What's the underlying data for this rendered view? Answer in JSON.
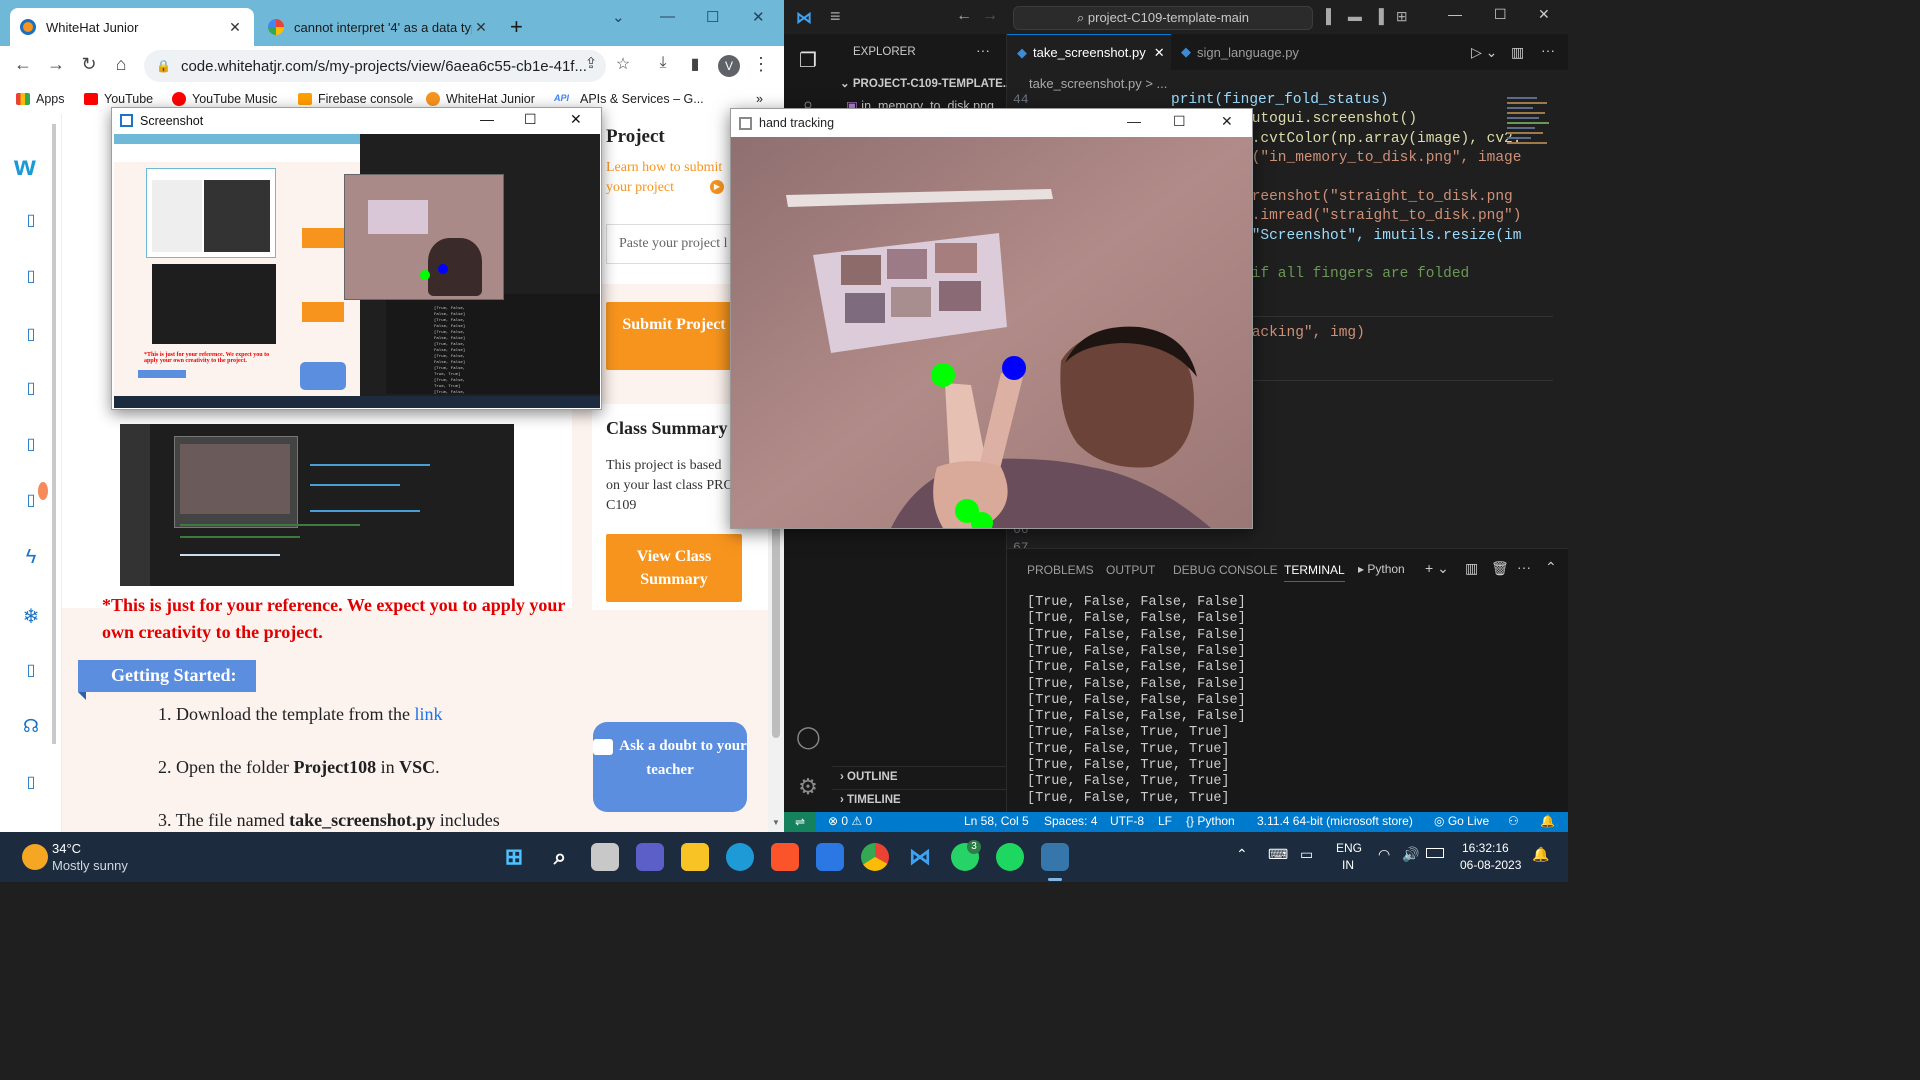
{
  "chrome": {
    "tabs": [
      {
        "title": "WhiteHat Junior",
        "close": "✕"
      },
      {
        "title": "cannot interpret '4' as a data type",
        "close": "✕"
      }
    ],
    "new_tab": "+",
    "url": "code.whitehatjr.com/s/my-projects/view/6aea6c55-cb1e-41f...",
    "profile": "V",
    "bookmarks": [
      "Apps",
      "YouTube",
      "YouTube Music",
      "Firebase console",
      "WhiteHat Junior",
      "APIs & Services – G..."
    ],
    "bookmarks_more": "»"
  },
  "page": {
    "project_heading": "Project",
    "learn_link": "Learn how to submit your project",
    "paste_placeholder": "Paste your project l",
    "submit_label": "Submit Project",
    "class_summary_title": "Class Summary",
    "class_summary_text": "This project is based on your last class PRO C109",
    "view_summary_label": "View Class Summary",
    "reference_note": "*This is just for your reference. We expect you to apply your own creativity to the project.",
    "getting_started": "Getting Started:",
    "steps": [
      {
        "prefix": "1. Download the template from the ",
        "link": "link"
      },
      {
        "prefix": "2. Open the folder ",
        "bold": "Project108",
        "suffix_pre": " in ",
        "bold2": "VSC",
        "suffix": "."
      },
      {
        "prefix": "3. The file named ",
        "bold": "take_screenshot.py",
        "suffix": " includes"
      }
    ],
    "ask_doubt": "Ask a doubt to your teacher"
  },
  "screenshot_window": {
    "title": "Screenshot"
  },
  "hand_window": {
    "title": "hand tracking",
    "landmark_colors": {
      "index_tip": "#00ff00",
      "middle_tip": "#0000ff",
      "thumb": "#00ff00"
    }
  },
  "vscode": {
    "search": "project-C109-template-main",
    "explorer_title": "EXPLORER",
    "project_folder": "PROJECT-C109-TEMPLATE...",
    "explorer_file": "in_memory_to_disk.png",
    "outline": "OUTLINE",
    "timeline": "TIMELINE",
    "tabs": [
      {
        "name": "take_screenshot.py",
        "close": "✕"
      },
      {
        "name": "sign_language.py"
      }
    ],
    "breadcrumb": "take_screenshot.py > ...",
    "line_numbers": [
      "44",
      "66",
      "67"
    ],
    "code_lines": [
      "print(finger_fold_status)",
      "autogui.screenshot()",
      "2.cvtColor(np.array(image), cv2.",
      "e(\"in_memory_to_disk.png\", image",
      "",
      "creenshot(\"straight_to_disk.png",
      "2.imread(\"straight_to_disk.png\")",
      "(\"Screenshot\", imutils.resize(im",
      "",
      " if all fingers are folded",
      "",
      "",
      "racking\", img)"
    ],
    "panel_tabs": [
      "PROBLEMS",
      "OUTPUT",
      "DEBUG CONSOLE",
      "TERMINAL"
    ],
    "terminal_kind": "Python",
    "terminal_lines": [
      "[True, False, False, False]",
      "[True, False, False, False]",
      "[True, False, False, False]",
      "[True, False, False, False]",
      "[True, False, False, False]",
      "[True, False, False, False]",
      "[True, False, False, False]",
      "[True, False, False, False]",
      "[True, False, True, True]",
      "[True, False, True, True]",
      "[True, False, True, True]",
      "[True, False, True, True]",
      "[True, False, True, True]"
    ],
    "status": {
      "problems": "⊗ 0 ⚠ 0",
      "position": "Ln 58, Col 5",
      "spaces": "Spaces: 4",
      "encoding": "UTF-8",
      "eol": "LF",
      "language": "{} Python",
      "interpreter": "3.11.4 64-bit (microsoft store)",
      "golive": "Go Live"
    }
  },
  "taskbar": {
    "temperature": "34°C",
    "weather": "Mostly sunny",
    "lang1": "ENG",
    "lang2": "IN",
    "time": "16:32:16",
    "date": "06-08-2023",
    "whatsapp_badge": "3"
  }
}
